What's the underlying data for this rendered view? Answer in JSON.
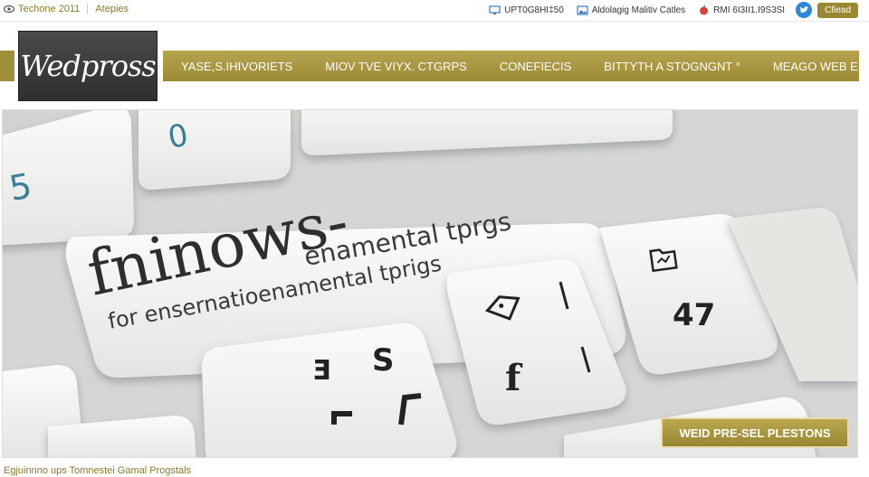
{
  "topbar": {
    "left_items": [
      "Techone 2011",
      "Atepies"
    ],
    "right_items": [
      {
        "icon": "monitor-icon",
        "label": "UPT0G8HI‡50"
      },
      {
        "icon": "image-icon",
        "label": "Aldolagig Malitiv Catles"
      },
      {
        "icon": "apple-icon",
        "label": "RMI 6I3II1.I9S3SI"
      }
    ],
    "bird_icon": "twitter-bird-icon",
    "button_label": "Cfiead"
  },
  "logo": {
    "text": "Wedpross"
  },
  "nav": {
    "items": [
      "YASE,S.IHIVORIETS",
      "MIOV TVE VIYX. CTGRPS",
      "CONEFIECIS",
      "BITTYTH A STOGNGNT °",
      "MEAGO WEB EFT"
    ]
  },
  "hero": {
    "keys": {
      "big_word": "fninows-",
      "subtitle_1": "enamental tprgs",
      "subtitle_2": "for ensernatioenamental tprigs",
      "num_0": "0",
      "num_5": "5",
      "num_47": "47",
      "key_3": "Ǝ",
      "key_s": "S",
      "key_f": "f"
    },
    "button_label": "WEID PRE-SEL PLESTONS"
  },
  "footer": {
    "link": "Egjuinnno ups Tomnestei Gamal Progstals"
  },
  "colors": {
    "accent": "#a3913b",
    "dark": "#3a3a3a",
    "key": "#f4f4f2"
  }
}
